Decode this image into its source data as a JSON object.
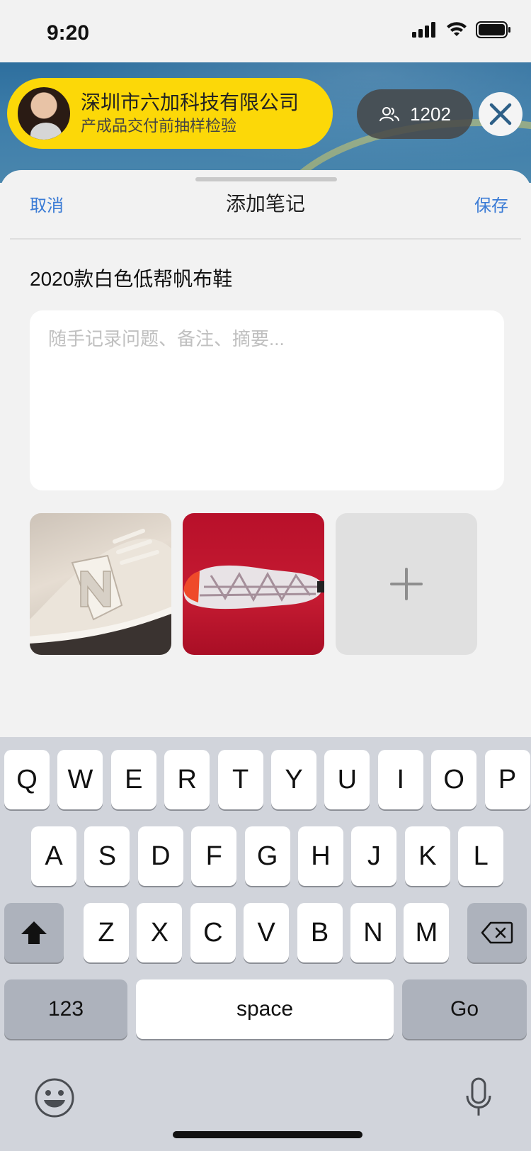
{
  "status_bar": {
    "time": "9:20"
  },
  "live": {
    "host_company": "深圳市六加科技有限公司",
    "host_subtitle": "产成品交付前抽样检验",
    "viewer_count": "1202"
  },
  "sheet": {
    "cancel_label": "取消",
    "title": "添加笔记",
    "save_label": "保存",
    "product_name": "2020款白色低帮帆布鞋",
    "note_placeholder": "随手记录问题、备注、摘要...",
    "note_value": "",
    "images": [
      {
        "alt": "white-sneaker-photo"
      },
      {
        "alt": "red-background-sole-photo"
      }
    ],
    "add_image_label": "+"
  },
  "keyboard": {
    "row1": [
      "Q",
      "W",
      "E",
      "R",
      "T",
      "Y",
      "U",
      "I",
      "O",
      "P"
    ],
    "row2": [
      "A",
      "S",
      "D",
      "F",
      "G",
      "H",
      "J",
      "K",
      "L"
    ],
    "row3": [
      "Z",
      "X",
      "C",
      "V",
      "B",
      "N",
      "M"
    ],
    "numbers_label": "123",
    "space_label": "space",
    "go_label": "Go"
  },
  "colors": {
    "accent": "#3a7bd5",
    "host_pill": "#fcd808",
    "keyboard_bg": "#d1d4db"
  }
}
